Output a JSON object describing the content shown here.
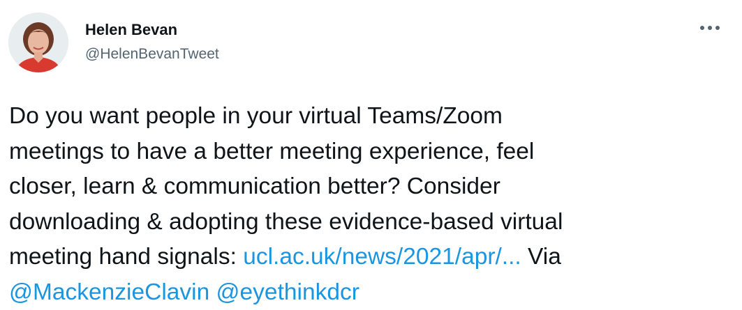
{
  "author": {
    "name": "Helen Bevan",
    "handle": "@HelenBevanTweet"
  },
  "menu": {
    "icon": "more-horizontal-icon"
  },
  "tweet": {
    "text_lines": [
      "Do you want people in your virtual Teams/Zoom",
      "meetings to have a better meeting experience, feel",
      "closer, learn & communication better? Consider",
      "downloading & adopting these evidence-based virtual",
      "meeting hand signals: "
    ],
    "link": "ucl.ac.uk/news/2021/apr/...",
    "via_text": " Via",
    "mentions": [
      "@MackenzieClavin",
      "@eyethinkdcr"
    ]
  },
  "colors": {
    "link": "#1b95e0",
    "text": "#0f1419",
    "secondary": "#536471"
  }
}
